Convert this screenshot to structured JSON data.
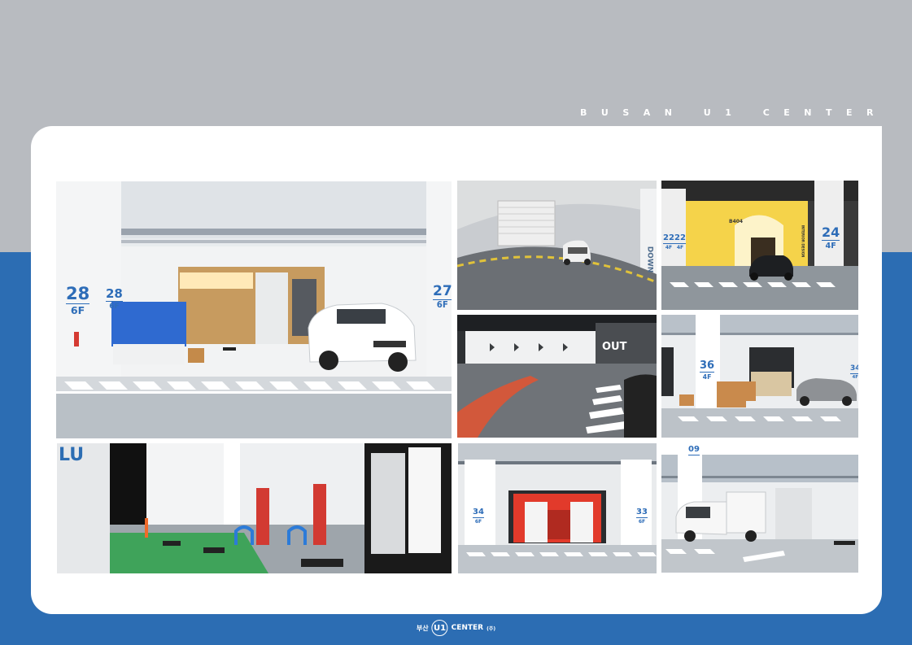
{
  "header": {
    "brand_text": "BUSAN U1 CENTER"
  },
  "colors": {
    "top_band": "#b8bbc0",
    "bottom_band": "#2c6db3",
    "card": "#ffffff",
    "pillar_number": "#2e6db8"
  },
  "photos": [
    {
      "id": "photo-1",
      "subject": "parking area with white SUV",
      "pillar_signs": [
        {
          "number": "28",
          "floor": "6F"
        },
        {
          "number": "28",
          "floor": "6F"
        },
        {
          "number": "27",
          "floor": "6F"
        }
      ]
    },
    {
      "id": "photo-2",
      "subject": "circular vehicle ramp",
      "wall_text": "DOWN"
    },
    {
      "id": "photo-3",
      "subject": "lit entrance with black car",
      "pillar_signs": [
        {
          "number": "22",
          "floor": "4F"
        },
        {
          "number": "22",
          "floor": "4F"
        },
        {
          "number": "24",
          "floor": "4F"
        }
      ],
      "door_sign": "B404",
      "side_sign": "INTERIOR DESIGN"
    },
    {
      "id": "photo-4",
      "subject": "ramp with exit sign",
      "wall_text": "OUT"
    },
    {
      "id": "photo-5",
      "subject": "loading dock with boxes",
      "pillar_signs": [
        {
          "number": "36",
          "floor": "4F"
        },
        {
          "number": "34",
          "floor": "4F"
        }
      ]
    },
    {
      "id": "photo-6",
      "subject": "electric vehicle chargers",
      "wall_text": "LU"
    },
    {
      "id": "photo-7",
      "subject": "red entrance corridor",
      "pillar_signs": [
        {
          "number": "34",
          "floor": "6F"
        },
        {
          "number": "33",
          "floor": "6F"
        }
      ]
    },
    {
      "id": "photo-8",
      "subject": "white delivery truck",
      "pillar_signs": [
        {
          "number": "09",
          "floor": ""
        }
      ]
    }
  ],
  "footer": {
    "city": "부산",
    "mark": "U1",
    "name": "CENTER",
    "suffix": "(주)"
  }
}
